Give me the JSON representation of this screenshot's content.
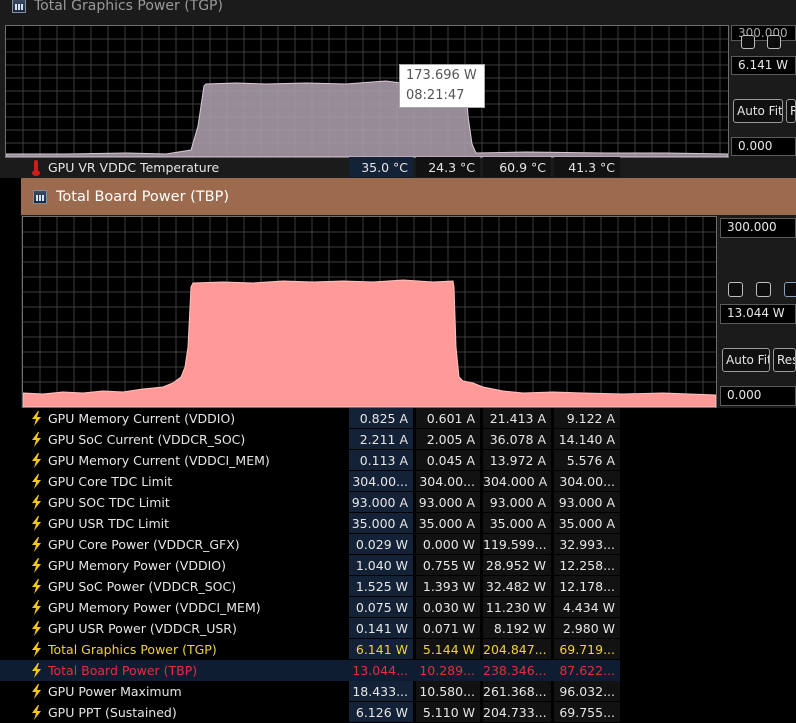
{
  "tgp": {
    "title": "Total Graphics Power (TGP)",
    "max_value": "300.000",
    "current_value": "6.141 W",
    "min_value": "0.000",
    "auto_fit_label": "Auto Fit",
    "reset_label": "Reset",
    "tooltip_value": "173.696 W",
    "tooltip_time": "08:21:47",
    "color": "#a99aa8"
  },
  "temp_row": {
    "label": "GPU VR VDDC Temperature",
    "values": [
      "35.0 °C",
      "24.3 °C",
      "60.9 °C",
      "41.3 °C"
    ]
  },
  "tbp": {
    "title": "Total Board Power (TBP)",
    "max_value": "300.000",
    "current_value": "13.044 W",
    "min_value": "0.000",
    "auto_fit_label": "Auto Fit",
    "reset_label": "Reset",
    "color": "#ff9a98",
    "title_bar_color": "#9c6a4c"
  },
  "sensors": [
    {
      "label": "GPU Memory Current (VDDIO)",
      "values": [
        "0.825 A",
        "0.601 A",
        "21.413 A",
        "9.122 A"
      ]
    },
    {
      "label": "GPU SoC Current (VDDCR_SOC)",
      "values": [
        "2.211 A",
        "2.005 A",
        "36.078 A",
        "14.140 A"
      ]
    },
    {
      "label": "GPU Memory Current (VDDCI_MEM)",
      "values": [
        "0.113 A",
        "0.045 A",
        "13.972 A",
        "5.576 A"
      ]
    },
    {
      "label": "GPU Core TDC Limit",
      "values": [
        "304.00...",
        "304.00...",
        "304.000 A",
        "304.00..."
      ]
    },
    {
      "label": "GPU SOC TDC Limit",
      "values": [
        "93.000 A",
        "93.000 A",
        "93.000 A",
        "93.000 A"
      ]
    },
    {
      "label": "GPU USR TDC Limit",
      "values": [
        "35.000 A",
        "35.000 A",
        "35.000 A",
        "35.000 A"
      ]
    },
    {
      "label": "GPU Core Power (VDDCR_GFX)",
      "values": [
        "0.029 W",
        "0.000 W",
        "119.599...",
        "32.993..."
      ]
    },
    {
      "label": "GPU Memory Power (VDDIO)",
      "values": [
        "1.040 W",
        "0.755 W",
        "28.952 W",
        "12.258..."
      ]
    },
    {
      "label": "GPU SoC Power (VDDCR_SOC)",
      "values": [
        "1.525 W",
        "1.393 W",
        "32.482 W",
        "12.178..."
      ]
    },
    {
      "label": "GPU Memory Power (VDDCI_MEM)",
      "values": [
        "0.075 W",
        "0.030 W",
        "11.230 W",
        "4.434 W"
      ]
    },
    {
      "label": "GPU USR Power (VDDCR_USR)",
      "values": [
        "0.141 W",
        "0.071 W",
        "8.192 W",
        "2.980 W"
      ]
    },
    {
      "label": "Total Graphics Power (TGP)",
      "values": [
        "6.141 W",
        "5.144 W",
        "204.847...",
        "69.719..."
      ],
      "style": "yellow"
    },
    {
      "label": "Total Board Power (TBP)",
      "values": [
        "13.044...",
        "10.289...",
        "238.346...",
        "87.622..."
      ],
      "style": "red"
    },
    {
      "label": "GPU Power Maximum",
      "values": [
        "18.433...",
        "10.580...",
        "261.368...",
        "96.032..."
      ]
    },
    {
      "label": "GPU PPT (Sustained)",
      "values": [
        "6.126 W",
        "5.110 W",
        "204.733...",
        "69.755..."
      ]
    }
  ],
  "colors": {
    "bolt": "#f5c518",
    "highlight_row": "#0f1d33",
    "value_current_bg": "#142238"
  }
}
